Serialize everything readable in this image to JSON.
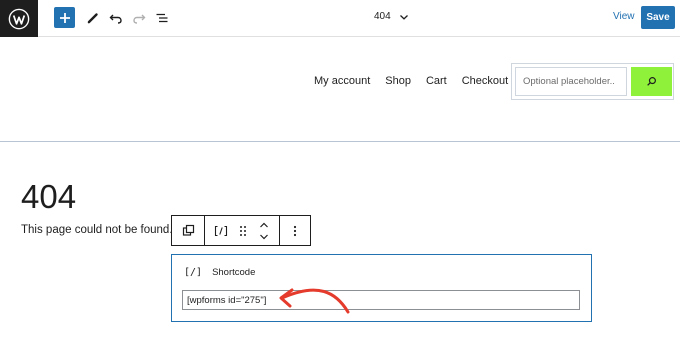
{
  "topbar": {
    "document_title": "404",
    "view_label": "View",
    "save_label": "Save"
  },
  "header": {
    "nav": [
      "My account",
      "Shop",
      "Cart",
      "Checkout"
    ],
    "search": {
      "placeholder": "Optional placeholder..",
      "value": ""
    }
  },
  "content": {
    "heading": "404",
    "message": "This page could not be found."
  },
  "block_toolbar": {
    "items": [
      "copy-icon",
      "shortcode-icon",
      "drag-handle-icon",
      "move-up-down-icon",
      "more-options-icon"
    ]
  },
  "shortcode_block": {
    "icon_text": "[/]",
    "label": "Shortcode",
    "value": "[wpforms id=\"275\"]"
  },
  "colors": {
    "accent": "#2271b1",
    "search_button": "#8ff13a",
    "annotation_arrow": "#e53b2c",
    "logo_bg": "#1e1e1e"
  }
}
